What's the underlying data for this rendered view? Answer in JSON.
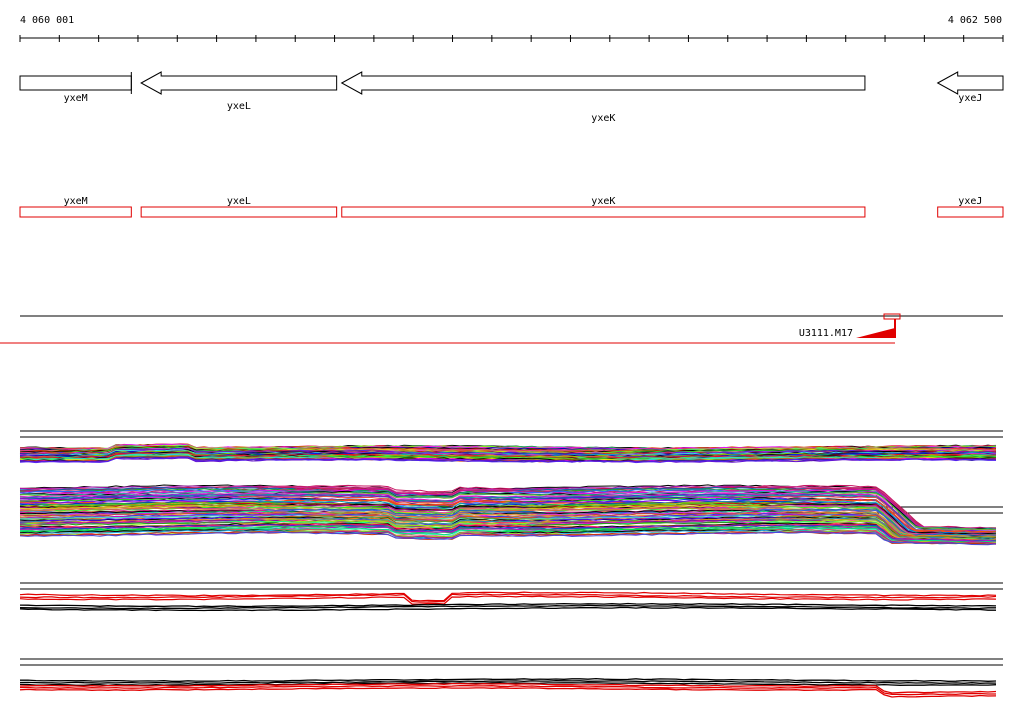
{
  "ruler": {
    "start_label": "4 060 001",
    "end_label": "4 062 500",
    "start": 4060001,
    "end": 4062500
  },
  "colors": {
    "gene": "#000000",
    "feature": "#e00000",
    "track_line": "#000000"
  },
  "genes": [
    {
      "name": "yxeM",
      "start": 4060001,
      "end": 4060284,
      "strand": "+"
    },
    {
      "name": "yxeL",
      "start": 4060309,
      "end": 4060806,
      "strand": "-"
    },
    {
      "name": "yxeK",
      "start": 4060819,
      "end": 4062149,
      "strand": "-"
    },
    {
      "name": "yxeJ",
      "start": 4062334,
      "end": 4062500,
      "strand": "-"
    }
  ],
  "features": [
    {
      "name": "yxeM",
      "start": 4060001,
      "end": 4060284
    },
    {
      "name": "yxeL",
      "start": 4060309,
      "end": 4060806
    },
    {
      "name": "yxeK",
      "start": 4060819,
      "end": 4062149
    },
    {
      "name": "yxeJ",
      "start": 4062334,
      "end": 4062500
    }
  ],
  "transcription_site": {
    "label": "U3111.M17",
    "position": 4062244
  },
  "expression_panels": [
    {
      "id": "panel-1",
      "line_count": 60,
      "palette": "multi"
    },
    {
      "id": "panel-2",
      "line_count": 90,
      "palette": "multi"
    },
    {
      "id": "panel-3",
      "line_count": 6,
      "palette": "red-black"
    },
    {
      "id": "panel-4",
      "line_count": 6,
      "palette": "red-black"
    }
  ]
}
